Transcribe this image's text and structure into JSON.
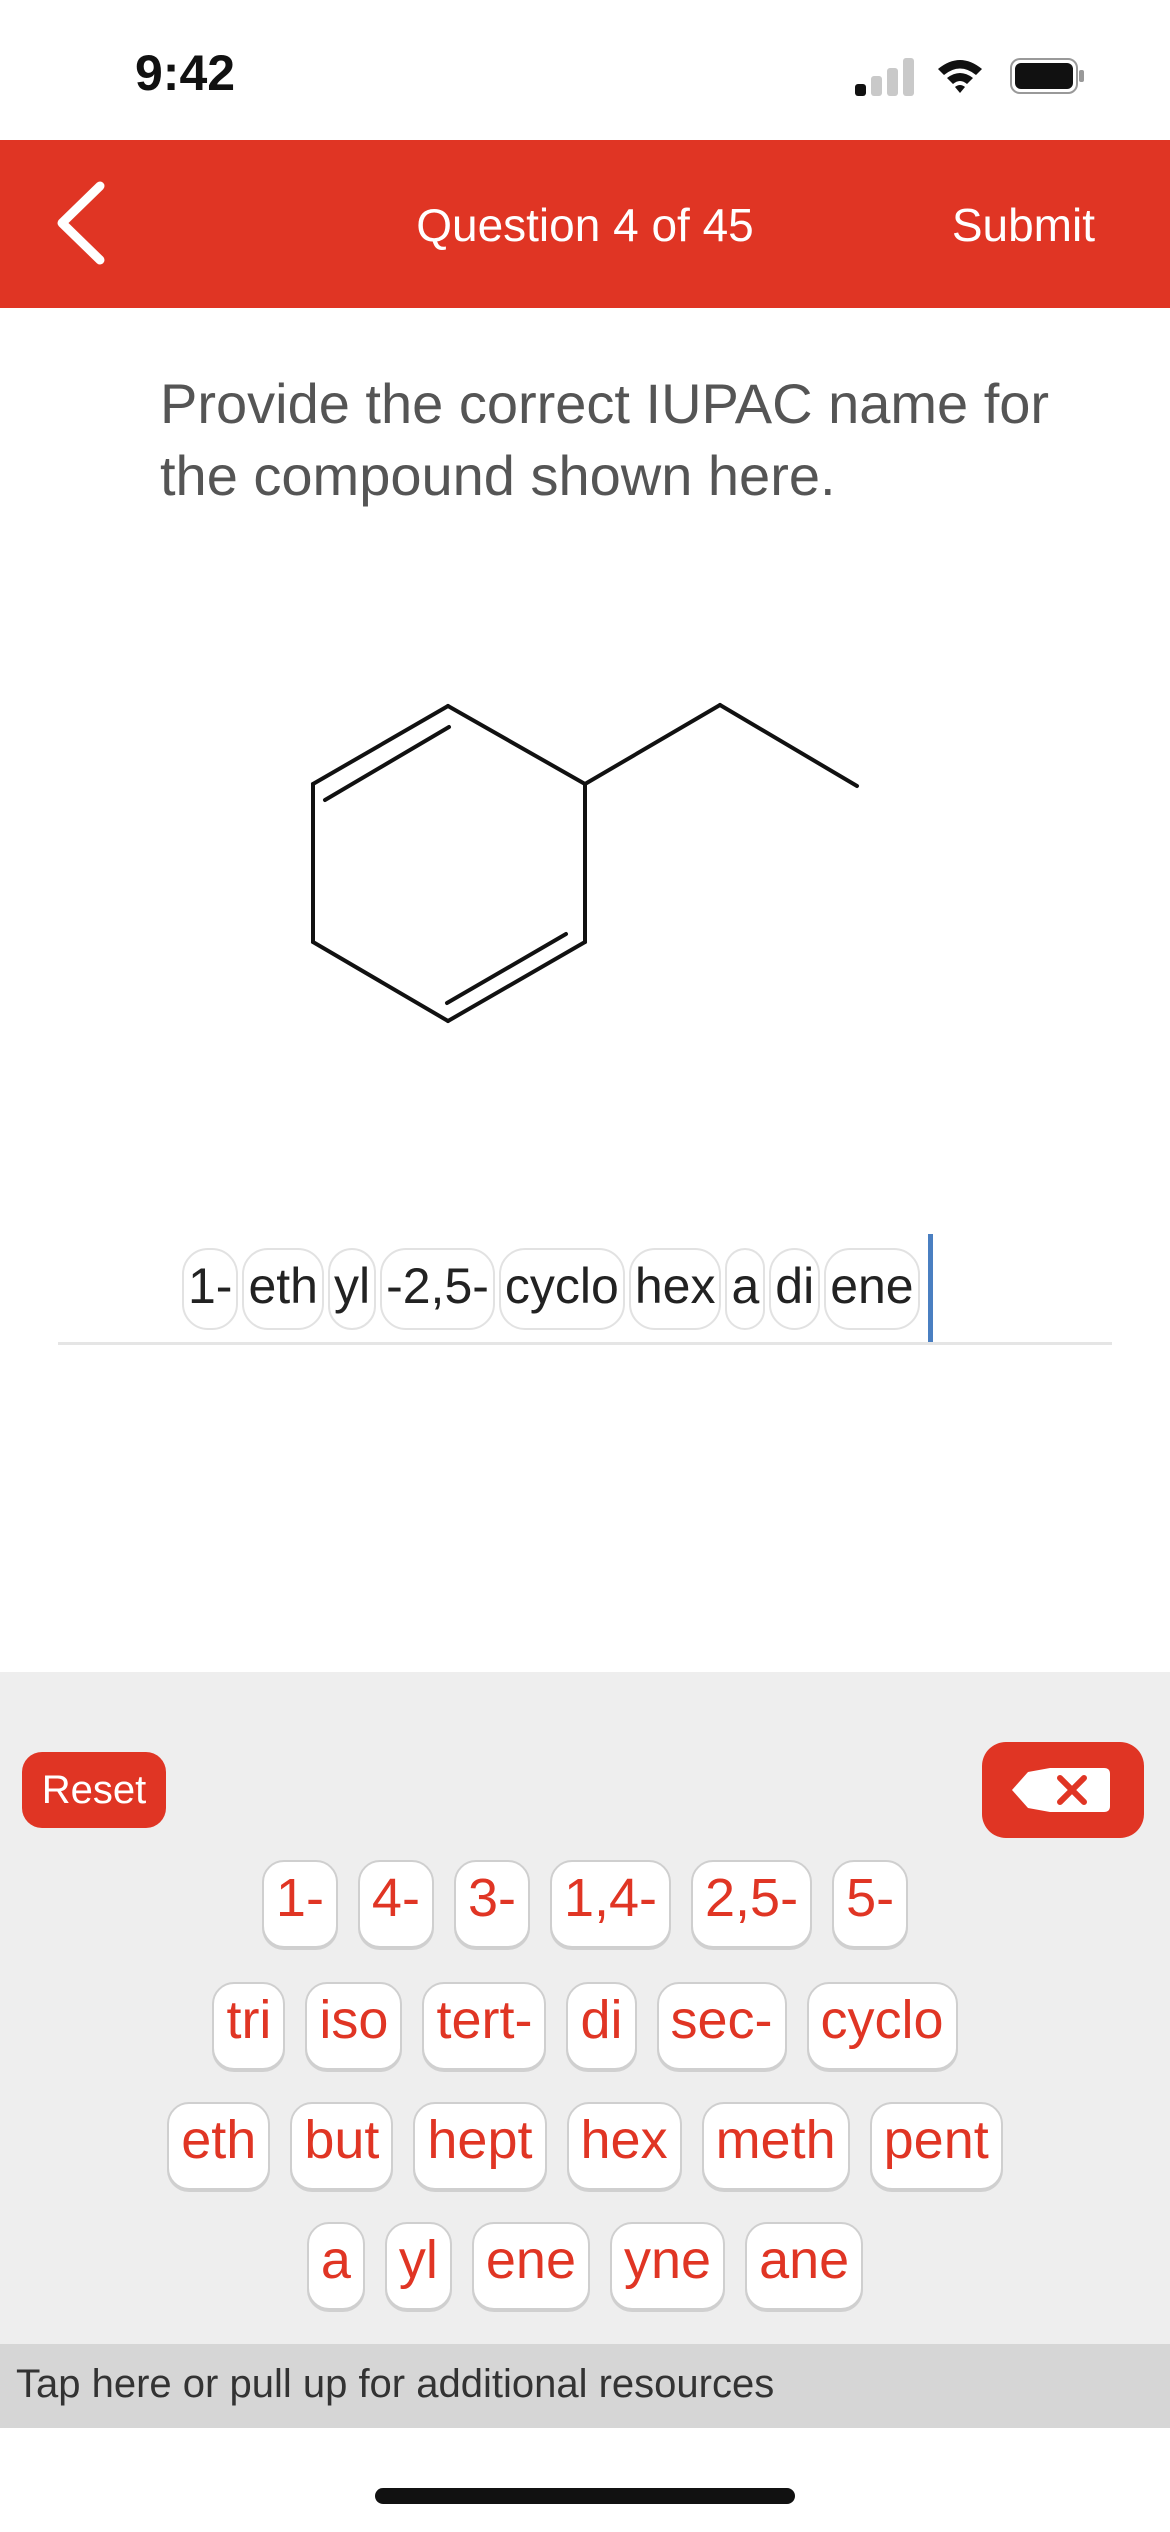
{
  "status_bar": {
    "time": "9:42"
  },
  "header": {
    "title": "Question 4 of 45",
    "submit_label": "Submit"
  },
  "question": {
    "prompt": "Provide the correct IUPAC name for the compound shown here."
  },
  "answer": {
    "tokens": [
      "1-",
      "eth",
      "yl",
      "-2,5-",
      "cyclo",
      "hex",
      "a",
      "di",
      "ene"
    ]
  },
  "keyboard": {
    "reset_label": "Reset",
    "rows": [
      [
        "1-",
        "4-",
        "3-",
        "1,4-",
        "2,5-",
        "5-"
      ],
      [
        "tri",
        "iso",
        "tert-",
        "di",
        "sec-",
        "cyclo"
      ],
      [
        "eth",
        "but",
        "hept",
        "hex",
        "meth",
        "pent"
      ],
      [
        "a",
        "yl",
        "ene",
        "yne",
        "ane"
      ]
    ]
  },
  "resources": {
    "label": "Tap here or pull up for additional resources"
  },
  "colors": {
    "accent": "#e03524",
    "cursor": "#4a7fc1"
  }
}
